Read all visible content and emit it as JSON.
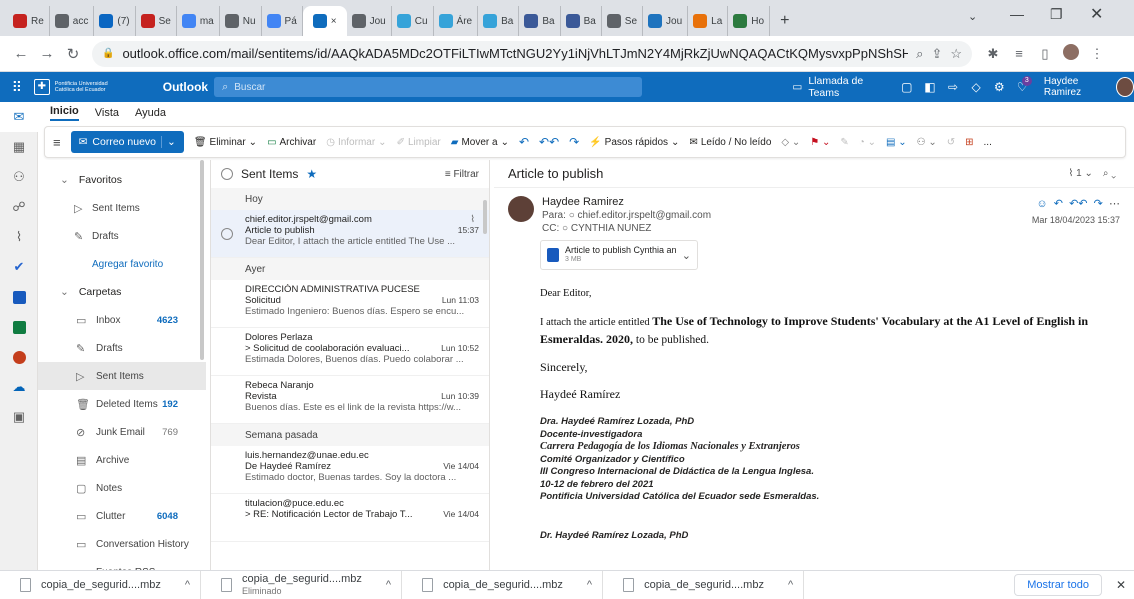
{
  "browser": {
    "tabs": [
      {
        "label": "Re",
        "color": "#c5221f"
      },
      {
        "label": "acc",
        "color": "#5f6368"
      },
      {
        "label": "(7)",
        "color": "#0a66c2"
      },
      {
        "label": "Se",
        "color": "#c5221f"
      },
      {
        "label": "ma",
        "color": "#4285f4"
      },
      {
        "label": "Nu",
        "color": "#5f6368"
      },
      {
        "label": "Pá",
        "color": "#4285f4"
      },
      {
        "label": "×",
        "color": "#0f6cbd",
        "active": true
      },
      {
        "label": "Jou",
        "color": "#5f6368"
      },
      {
        "label": "Cu",
        "color": "#36a3d9"
      },
      {
        "label": "Áre",
        "color": "#36a3d9"
      },
      {
        "label": "Ba",
        "color": "#36a3d9"
      },
      {
        "label": "Ba",
        "color": "#3b5998"
      },
      {
        "label": "Ba",
        "color": "#3b5998"
      },
      {
        "label": "Se",
        "color": "#5f6368"
      },
      {
        "label": "Jou",
        "color": "#1e73be"
      },
      {
        "label": "La",
        "color": "#e8710a"
      },
      {
        "label": "Ho",
        "color": "#2c7a3f"
      }
    ],
    "new_tab": "+",
    "url": "outlook.office.com/mail/sentitems/id/AAQkADA5MDc2OTFiLTIwMTctNGU2Yy1iNjVhLTJmN2Y4MjRkZjUwNQAQACtKQMysvxpPpNShSHj70..."
  },
  "outlook": {
    "university": "Pontificia Universidad Católica del Ecuador",
    "app_name": "Outlook",
    "search_placeholder": "Buscar",
    "teams_call": "Llamada de Teams",
    "notification_count": "3",
    "user_name": "Haydee Ramirez"
  },
  "ribbon": {
    "tabs": [
      "Inicio",
      "Vista",
      "Ayuda"
    ],
    "new_mail": "Correo nuevo",
    "delete": "Eliminar",
    "archive": "Archivar",
    "report": "Informar",
    "sweep": "Limpiar",
    "move_to": "Mover a",
    "quick_steps": "Pasos rápidos",
    "read_unread": "Leído / No leído",
    "more": "..."
  },
  "folders": {
    "favorites_label": "Favoritos",
    "favorites": [
      {
        "label": "Sent Items",
        "icon": "send-icon"
      },
      {
        "label": "Drafts",
        "icon": "pencil-icon"
      }
    ],
    "add_favorite": "Agregar favorito",
    "folders_label": "Carpetas",
    "items": [
      {
        "label": "Inbox",
        "count": "4623",
        "icon": "inbox-icon"
      },
      {
        "label": "Drafts",
        "count": "",
        "icon": "pencil-icon"
      },
      {
        "label": "Sent Items",
        "count": "",
        "icon": "send-icon"
      },
      {
        "label": "Deleted Items",
        "count": "192",
        "icon": "trash-icon"
      },
      {
        "label": "Junk Email",
        "count": "769",
        "icon": "junk-icon"
      },
      {
        "label": "Archive",
        "count": "",
        "icon": "archive-icon"
      },
      {
        "label": "Notes",
        "count": "",
        "icon": "note-icon"
      },
      {
        "label": "Clutter",
        "count": "6048",
        "icon": "folder-icon"
      },
      {
        "label": "Conversation History",
        "count": "",
        "icon": "folder-icon"
      },
      {
        "label": "Fuentes RSS",
        "count": "",
        "icon": "folder-icon"
      }
    ]
  },
  "message_list": {
    "title": "Sent Items",
    "filter": "Filtrar",
    "groups": [
      {
        "label": "Hoy",
        "messages": [
          {
            "from": "chief.editor.jrspelt@gmail.com",
            "subject": "Article to publish",
            "time": "15:37",
            "preview": "Dear Editor, I attach the article entitled The Use ..."
          }
        ]
      },
      {
        "label": "Ayer",
        "messages": [
          {
            "from": "DIRECCIÓN ADMINISTRATIVA PUCESE",
            "subject": "Solicitud",
            "time": "Lun 11:03",
            "preview": "Estimado Ingeniero: Buenos días. Espero se encu..."
          },
          {
            "from": "Dolores Perlaza",
            "subject": "> Solicitud de coolaboración evaluaci...",
            "time": "Lun 10:52",
            "preview": "Estimada Dolores, Buenos días. Puedo colaborar ..."
          },
          {
            "from": "Rebeca Naranjo",
            "subject": "Revista",
            "time": "Lun 10:39",
            "preview": "Buenos días. Este es el link de la revista https://w..."
          }
        ]
      },
      {
        "label": "Semana pasada",
        "messages": [
          {
            "from": "luis.hernandez@unae.edu.ec",
            "subject": "De Haydeé Ramírez",
            "time": "Vie 14/04",
            "preview": "Estimado doctor, Buenas tardes. Soy la doctora ..."
          },
          {
            "from": "titulacion@puce.edu.ec",
            "subject": "> RE: Notificación Lector de Trabajo T...",
            "time": "Vie 14/04",
            "preview": ""
          }
        ]
      }
    ]
  },
  "reading": {
    "title": "Article to publish",
    "counter": "1",
    "sender": "Haydee Ramirez",
    "to_label": "Para:",
    "to": "chief.editor.jrspelt@gmail.com",
    "cc_label": "CC:",
    "cc": "CYNTHIA NUNEZ",
    "date": "Mar 18/04/2023 15:37",
    "attachment_name": "Article to publish Cynthia an...",
    "attachment_size": "3 MB",
    "greeting": "Dear Editor,",
    "body_pre": "I attach the article entitled ",
    "body_bold": "The Use of Technology to Improve Students' Vocabulary at the A1 Level of English in Esmeraldas. 2020,",
    "body_post": " to be published.",
    "closing": "Sincerely,",
    "signature_name": "Haydeé Ramírez",
    "sig_lines": [
      "Dra. Haydeé Ramírez Lozada, PhD",
      "Docente-investigadora",
      "Carrera Pedagogía de los Idiomas Nacionales y Extranjeros",
      "Comité Organizador y Científico",
      "III Congreso Internacional de Didáctica de la Lengua Inglesa.",
      "10-12 de febrero del 2021",
      "Pontificia Universidad Católica del Ecuador sede Esmeraldas."
    ],
    "sig_repeat": "Dr. Haydeé Ramírez Lozada, PhD"
  },
  "downloads": {
    "items": [
      {
        "name": "copia_de_segurid....mbz",
        "status": ""
      },
      {
        "name": "copia_de_segurid....mbz",
        "status": "Eliminado"
      },
      {
        "name": "copia_de_segurid....mbz",
        "status": ""
      },
      {
        "name": "copia_de_segurid....mbz",
        "status": ""
      }
    ],
    "show_all": "Mostrar todo"
  }
}
